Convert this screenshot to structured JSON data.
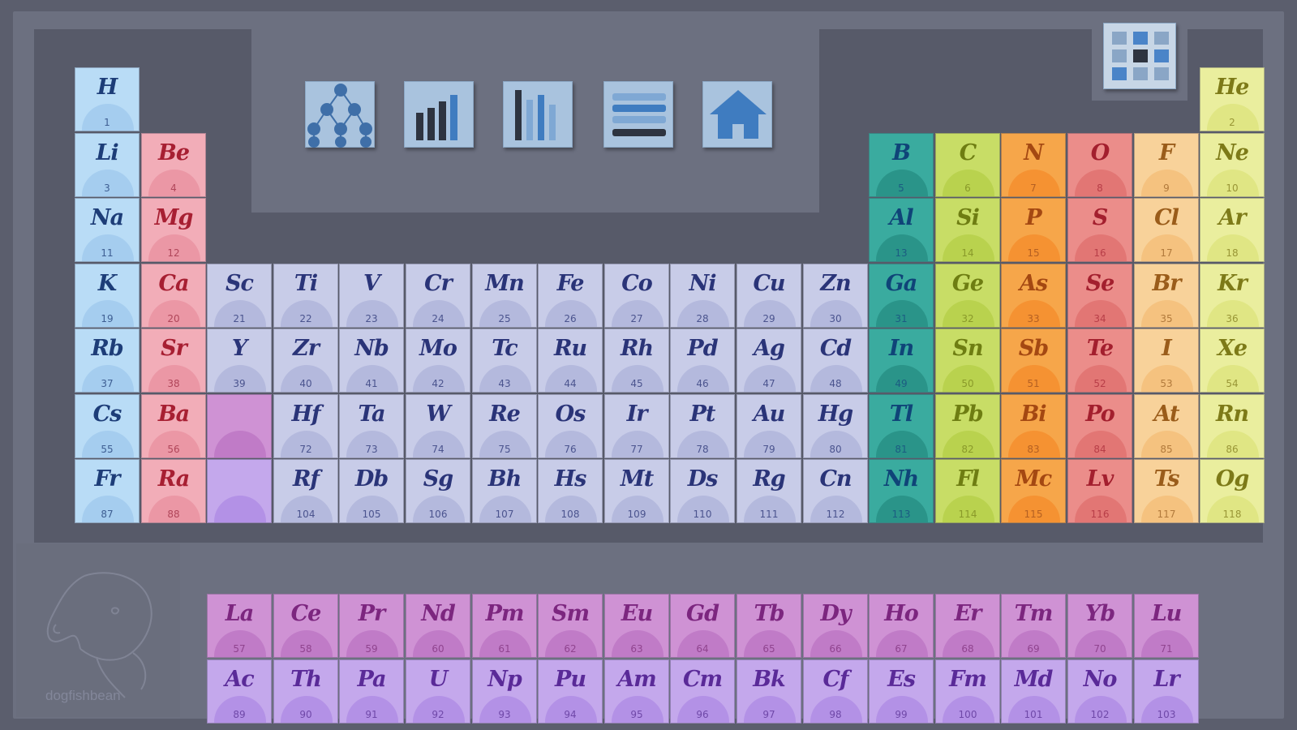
{
  "toolbar": {
    "buttons": [
      {
        "icon": "hierarchy-icon"
      },
      {
        "icon": "bar-chart-icon"
      },
      {
        "icon": "column-chart-icon"
      },
      {
        "icon": "list-icon"
      },
      {
        "icon": "home-icon"
      }
    ],
    "grid_button_icon": "grid-icon"
  },
  "watermark": {
    "text": "dogfishbean"
  },
  "categories": {
    "hydrogen": {
      "bg": "#b9dcf6",
      "arc": "#a5cdef",
      "sym": "#1d3d78",
      "num": "#3e5e92"
    },
    "alkali": {
      "bg": "#b9dcf6",
      "arc": "#a5cdef",
      "sym": "#1d3d78",
      "num": "#3e5e92"
    },
    "alkaline": {
      "bg": "#f2adb8",
      "arc": "#eb97a5",
      "sym": "#a71f32",
      "num": "#b0465a"
    },
    "transition": {
      "bg": "#c8cce8",
      "arc": "#b4b9dd",
      "sym": "#2a3478",
      "num": "#4b548e"
    },
    "boron": {
      "bg": "#3aab9f",
      "arc": "#2a9489",
      "sym": "#0f4478",
      "num": "#1b5c82"
    },
    "carbon": {
      "bg": "#c8dd66",
      "arc": "#b9d24e",
      "sym": "#6e7d12",
      "num": "#8a9a2a"
    },
    "pnictogen": {
      "bg": "#f6a64a",
      "arc": "#f59232",
      "sym": "#a44812",
      "num": "#b56022"
    },
    "chalcogen": {
      "bg": "#eb8d8a",
      "arc": "#e27674",
      "sym": "#a31f2e",
      "num": "#b83e48"
    },
    "halogen": {
      "bg": "#f8d29a",
      "arc": "#f5c27f",
      "sym": "#9a5c1a",
      "num": "#b27a3c"
    },
    "noble": {
      "bg": "#eaee9e",
      "arc": "#e0e684",
      "sym": "#7d7a18",
      "num": "#999636"
    },
    "lanthanide": {
      "bg": "#cf92d4",
      "arc": "#c07bc7",
      "sym": "#7c267f",
      "num": "#90448f"
    },
    "actinide": {
      "bg": "#c4a8ec",
      "arc": "#b391e6",
      "sym": "#5a2a98",
      "num": "#6f48a8"
    }
  },
  "elements": [
    {
      "symbol": "H",
      "number": 1,
      "cat": "hydrogen",
      "col": 1,
      "row": 1
    },
    {
      "symbol": "He",
      "number": 2,
      "cat": "noble",
      "col": 18,
      "row": 1
    },
    {
      "symbol": "Li",
      "number": 3,
      "cat": "alkali",
      "col": 1,
      "row": 2
    },
    {
      "symbol": "Be",
      "number": 4,
      "cat": "alkaline",
      "col": 2,
      "row": 2
    },
    {
      "symbol": "B",
      "number": 5,
      "cat": "boron",
      "col": 13,
      "row": 2
    },
    {
      "symbol": "C",
      "number": 6,
      "cat": "carbon",
      "col": 14,
      "row": 2
    },
    {
      "symbol": "N",
      "number": 7,
      "cat": "pnictogen",
      "col": 15,
      "row": 2
    },
    {
      "symbol": "O",
      "number": 8,
      "cat": "chalcogen",
      "col": 16,
      "row": 2
    },
    {
      "symbol": "F",
      "number": 9,
      "cat": "halogen",
      "col": 17,
      "row": 2
    },
    {
      "symbol": "Ne",
      "number": 10,
      "cat": "noble",
      "col": 18,
      "row": 2
    },
    {
      "symbol": "Na",
      "number": 11,
      "cat": "alkali",
      "col": 1,
      "row": 3
    },
    {
      "symbol": "Mg",
      "number": 12,
      "cat": "alkaline",
      "col": 2,
      "row": 3
    },
    {
      "symbol": "Al",
      "number": 13,
      "cat": "boron",
      "col": 13,
      "row": 3
    },
    {
      "symbol": "Si",
      "number": 14,
      "cat": "carbon",
      "col": 14,
      "row": 3
    },
    {
      "symbol": "P",
      "number": 15,
      "cat": "pnictogen",
      "col": 15,
      "row": 3
    },
    {
      "symbol": "S",
      "number": 16,
      "cat": "chalcogen",
      "col": 16,
      "row": 3
    },
    {
      "symbol": "Cl",
      "number": 17,
      "cat": "halogen",
      "col": 17,
      "row": 3
    },
    {
      "symbol": "Ar",
      "number": 18,
      "cat": "noble",
      "col": 18,
      "row": 3
    },
    {
      "symbol": "K",
      "number": 19,
      "cat": "alkali",
      "col": 1,
      "row": 4
    },
    {
      "symbol": "Ca",
      "number": 20,
      "cat": "alkaline",
      "col": 2,
      "row": 4
    },
    {
      "symbol": "Sc",
      "number": 21,
      "cat": "transition",
      "col": 3,
      "row": 4
    },
    {
      "symbol": "Ti",
      "number": 22,
      "cat": "transition",
      "col": 4,
      "row": 4
    },
    {
      "symbol": "V",
      "number": 23,
      "cat": "transition",
      "col": 5,
      "row": 4
    },
    {
      "symbol": "Cr",
      "number": 24,
      "cat": "transition",
      "col": 6,
      "row": 4
    },
    {
      "symbol": "Mn",
      "number": 25,
      "cat": "transition",
      "col": 7,
      "row": 4
    },
    {
      "symbol": "Fe",
      "number": 26,
      "cat": "transition",
      "col": 8,
      "row": 4
    },
    {
      "symbol": "Co",
      "number": 27,
      "cat": "transition",
      "col": 9,
      "row": 4
    },
    {
      "symbol": "Ni",
      "number": 28,
      "cat": "transition",
      "col": 10,
      "row": 4
    },
    {
      "symbol": "Cu",
      "number": 29,
      "cat": "transition",
      "col": 11,
      "row": 4
    },
    {
      "symbol": "Zn",
      "number": 30,
      "cat": "transition",
      "col": 12,
      "row": 4
    },
    {
      "symbol": "Ga",
      "number": 31,
      "cat": "boron",
      "col": 13,
      "row": 4
    },
    {
      "symbol": "Ge",
      "number": 32,
      "cat": "carbon",
      "col": 14,
      "row": 4
    },
    {
      "symbol": "As",
      "number": 33,
      "cat": "pnictogen",
      "col": 15,
      "row": 4
    },
    {
      "symbol": "Se",
      "number": 34,
      "cat": "chalcogen",
      "col": 16,
      "row": 4
    },
    {
      "symbol": "Br",
      "number": 35,
      "cat": "halogen",
      "col": 17,
      "row": 4
    },
    {
      "symbol": "Kr",
      "number": 36,
      "cat": "noble",
      "col": 18,
      "row": 4
    },
    {
      "symbol": "Rb",
      "number": 37,
      "cat": "alkali",
      "col": 1,
      "row": 5
    },
    {
      "symbol": "Sr",
      "number": 38,
      "cat": "alkaline",
      "col": 2,
      "row": 5
    },
    {
      "symbol": "Y",
      "number": 39,
      "cat": "transition",
      "col": 3,
      "row": 5
    },
    {
      "symbol": "Zr",
      "number": 40,
      "cat": "transition",
      "col": 4,
      "row": 5
    },
    {
      "symbol": "Nb",
      "number": 41,
      "cat": "transition",
      "col": 5,
      "row": 5
    },
    {
      "symbol": "Mo",
      "number": 42,
      "cat": "transition",
      "col": 6,
      "row": 5
    },
    {
      "symbol": "Tc",
      "number": 43,
      "cat": "transition",
      "col": 7,
      "row": 5
    },
    {
      "symbol": "Ru",
      "number": 44,
      "cat": "transition",
      "col": 8,
      "row": 5
    },
    {
      "symbol": "Rh",
      "number": 45,
      "cat": "transition",
      "col": 9,
      "row": 5
    },
    {
      "symbol": "Pd",
      "number": 46,
      "cat": "transition",
      "col": 10,
      "row": 5
    },
    {
      "symbol": "Ag",
      "number": 47,
      "cat": "transition",
      "col": 11,
      "row": 5
    },
    {
      "symbol": "Cd",
      "number": 48,
      "cat": "transition",
      "col": 12,
      "row": 5
    },
    {
      "symbol": "In",
      "number": 49,
      "cat": "boron",
      "col": 13,
      "row": 5
    },
    {
      "symbol": "Sn",
      "number": 50,
      "cat": "carbon",
      "col": 14,
      "row": 5
    },
    {
      "symbol": "Sb",
      "number": 51,
      "cat": "pnictogen",
      "col": 15,
      "row": 5
    },
    {
      "symbol": "Te",
      "number": 52,
      "cat": "chalcogen",
      "col": 16,
      "row": 5
    },
    {
      "symbol": "I",
      "number": 53,
      "cat": "halogen",
      "col": 17,
      "row": 5
    },
    {
      "symbol": "Xe",
      "number": 54,
      "cat": "noble",
      "col": 18,
      "row": 5
    },
    {
      "symbol": "Cs",
      "number": 55,
      "cat": "alkali",
      "col": 1,
      "row": 6
    },
    {
      "symbol": "Ba",
      "number": 56,
      "cat": "alkaline",
      "col": 2,
      "row": 6
    },
    {
      "symbol": "",
      "number": "",
      "cat": "lanthanide",
      "col": 3,
      "row": 6
    },
    {
      "symbol": "Hf",
      "number": 72,
      "cat": "transition",
      "col": 4,
      "row": 6
    },
    {
      "symbol": "Ta",
      "number": 73,
      "cat": "transition",
      "col": 5,
      "row": 6
    },
    {
      "symbol": "W",
      "number": 74,
      "cat": "transition",
      "col": 6,
      "row": 6
    },
    {
      "symbol": "Re",
      "number": 75,
      "cat": "transition",
      "col": 7,
      "row": 6
    },
    {
      "symbol": "Os",
      "number": 76,
      "cat": "transition",
      "col": 8,
      "row": 6
    },
    {
      "symbol": "Ir",
      "number": 77,
      "cat": "transition",
      "col": 9,
      "row": 6
    },
    {
      "symbol": "Pt",
      "number": 78,
      "cat": "transition",
      "col": 10,
      "row": 6
    },
    {
      "symbol": "Au",
      "number": 79,
      "cat": "transition",
      "col": 11,
      "row": 6
    },
    {
      "symbol": "Hg",
      "number": 80,
      "cat": "transition",
      "col": 12,
      "row": 6
    },
    {
      "symbol": "Tl",
      "number": 81,
      "cat": "boron",
      "col": 13,
      "row": 6
    },
    {
      "symbol": "Pb",
      "number": 82,
      "cat": "carbon",
      "col": 14,
      "row": 6
    },
    {
      "symbol": "Bi",
      "number": 83,
      "cat": "pnictogen",
      "col": 15,
      "row": 6
    },
    {
      "symbol": "Po",
      "number": 84,
      "cat": "chalcogen",
      "col": 16,
      "row": 6
    },
    {
      "symbol": "At",
      "number": 85,
      "cat": "halogen",
      "col": 17,
      "row": 6
    },
    {
      "symbol": "Rn",
      "number": 86,
      "cat": "noble",
      "col": 18,
      "row": 6
    },
    {
      "symbol": "Fr",
      "number": 87,
      "cat": "alkali",
      "col": 1,
      "row": 7
    },
    {
      "symbol": "Ra",
      "number": 88,
      "cat": "alkaline",
      "col": 2,
      "row": 7
    },
    {
      "symbol": "",
      "number": "",
      "cat": "actinide",
      "col": 3,
      "row": 7
    },
    {
      "symbol": "Rf",
      "number": 104,
      "cat": "transition",
      "col": 4,
      "row": 7
    },
    {
      "symbol": "Db",
      "number": 105,
      "cat": "transition",
      "col": 5,
      "row": 7
    },
    {
      "symbol": "Sg",
      "number": 106,
      "cat": "transition",
      "col": 6,
      "row": 7
    },
    {
      "symbol": "Bh",
      "number": 107,
      "cat": "transition",
      "col": 7,
      "row": 7
    },
    {
      "symbol": "Hs",
      "number": 108,
      "cat": "transition",
      "col": 8,
      "row": 7
    },
    {
      "symbol": "Mt",
      "number": 109,
      "cat": "transition",
      "col": 9,
      "row": 7
    },
    {
      "symbol": "Ds",
      "number": 110,
      "cat": "transition",
      "col": 10,
      "row": 7
    },
    {
      "symbol": "Rg",
      "number": 111,
      "cat": "transition",
      "col": 11,
      "row": 7
    },
    {
      "symbol": "Cn",
      "number": 112,
      "cat": "transition",
      "col": 12,
      "row": 7
    },
    {
      "symbol": "Nh",
      "number": 113,
      "cat": "boron",
      "col": 13,
      "row": 7
    },
    {
      "symbol": "Fl",
      "number": 114,
      "cat": "carbon",
      "col": 14,
      "row": 7
    },
    {
      "symbol": "Mc",
      "number": 115,
      "cat": "pnictogen",
      "col": 15,
      "row": 7
    },
    {
      "symbol": "Lv",
      "number": 116,
      "cat": "chalcogen",
      "col": 16,
      "row": 7
    },
    {
      "symbol": "Ts",
      "number": 117,
      "cat": "halogen",
      "col": 17,
      "row": 7
    },
    {
      "symbol": "Og",
      "number": 118,
      "cat": "noble",
      "col": 18,
      "row": 7
    },
    {
      "symbol": "La",
      "number": 57,
      "cat": "lanthanide",
      "col": 3,
      "row": 9
    },
    {
      "symbol": "Ce",
      "number": 58,
      "cat": "lanthanide",
      "col": 4,
      "row": 9
    },
    {
      "symbol": "Pr",
      "number": 59,
      "cat": "lanthanide",
      "col": 5,
      "row": 9
    },
    {
      "symbol": "Nd",
      "number": 60,
      "cat": "lanthanide",
      "col": 6,
      "row": 9
    },
    {
      "symbol": "Pm",
      "number": 61,
      "cat": "lanthanide",
      "col": 7,
      "row": 9
    },
    {
      "symbol": "Sm",
      "number": 62,
      "cat": "lanthanide",
      "col": 8,
      "row": 9
    },
    {
      "symbol": "Eu",
      "number": 63,
      "cat": "lanthanide",
      "col": 9,
      "row": 9
    },
    {
      "symbol": "Gd",
      "number": 64,
      "cat": "lanthanide",
      "col": 10,
      "row": 9
    },
    {
      "symbol": "Tb",
      "number": 65,
      "cat": "lanthanide",
      "col": 11,
      "row": 9
    },
    {
      "symbol": "Dy",
      "number": 66,
      "cat": "lanthanide",
      "col": 12,
      "row": 9
    },
    {
      "symbol": "Ho",
      "number": 67,
      "cat": "lanthanide",
      "col": 13,
      "row": 9
    },
    {
      "symbol": "Er",
      "number": 68,
      "cat": "lanthanide",
      "col": 14,
      "row": 9
    },
    {
      "symbol": "Tm",
      "number": 69,
      "cat": "lanthanide",
      "col": 15,
      "row": 9
    },
    {
      "symbol": "Yb",
      "number": 70,
      "cat": "lanthanide",
      "col": 16,
      "row": 9
    },
    {
      "symbol": "Lu",
      "number": 71,
      "cat": "lanthanide",
      "col": 17,
      "row": 9
    },
    {
      "symbol": "Ac",
      "number": 89,
      "cat": "actinide",
      "col": 3,
      "row": 10
    },
    {
      "symbol": "Th",
      "number": 90,
      "cat": "actinide",
      "col": 4,
      "row": 10
    },
    {
      "symbol": "Pa",
      "number": 91,
      "cat": "actinide",
      "col": 5,
      "row": 10
    },
    {
      "symbol": "U",
      "number": 92,
      "cat": "actinide",
      "col": 6,
      "row": 10
    },
    {
      "symbol": "Np",
      "number": 93,
      "cat": "actinide",
      "col": 7,
      "row": 10
    },
    {
      "symbol": "Pu",
      "number": 94,
      "cat": "actinide",
      "col": 8,
      "row": 10
    },
    {
      "symbol": "Am",
      "number": 95,
      "cat": "actinide",
      "col": 9,
      "row": 10
    },
    {
      "symbol": "Cm",
      "number": 96,
      "cat": "actinide",
      "col": 10,
      "row": 10
    },
    {
      "symbol": "Bk",
      "number": 97,
      "cat": "actinide",
      "col": 11,
      "row": 10
    },
    {
      "symbol": "Cf",
      "number": 98,
      "cat": "actinide",
      "col": 12,
      "row": 10
    },
    {
      "symbol": "Es",
      "number": 99,
      "cat": "actinide",
      "col": 13,
      "row": 10
    },
    {
      "symbol": "Fm",
      "number": 100,
      "cat": "actinide",
      "col": 14,
      "row": 10
    },
    {
      "symbol": "Md",
      "number": 101,
      "cat": "actinide",
      "col": 15,
      "row": 10
    },
    {
      "symbol": "No",
      "number": 102,
      "cat": "actinide",
      "col": 16,
      "row": 10
    },
    {
      "symbol": "Lr",
      "number": 103,
      "cat": "actinide",
      "col": 17,
      "row": 10
    }
  ]
}
